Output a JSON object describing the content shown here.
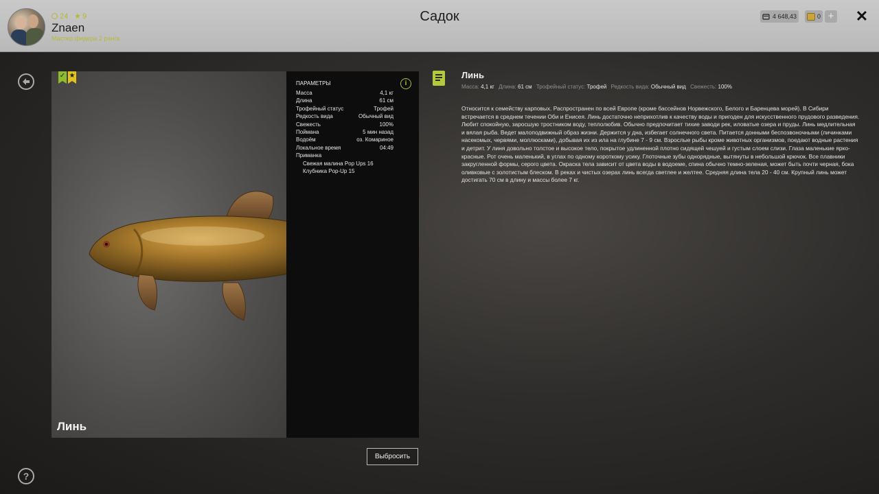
{
  "header": {
    "title": "Садок",
    "player": {
      "name": "Znaen",
      "rank": "Мастер фидера 2 ранга",
      "level": "24",
      "stars": "9"
    },
    "money": "4 648,43",
    "gold": "0",
    "plus_label": "+",
    "close_label": "✕"
  },
  "fish": {
    "name": "Линь",
    "colors": {
      "accent": "#b5c93e",
      "badge_green": "#8ebc2e",
      "badge_yellow": "#e2c21f"
    }
  },
  "params": {
    "title": "ПАРАМЕТРЫ",
    "rows": [
      {
        "label": "Масса",
        "value": "4,1 кг"
      },
      {
        "label": "Длина",
        "value": "61 см"
      },
      {
        "label": "Трофейный статус",
        "value": "Трофей"
      },
      {
        "label": "Редкость вида",
        "value": "Обычный вид"
      },
      {
        "label": "Свежесть",
        "value": "100%"
      },
      {
        "label": "Поймана",
        "value": "5 мин назад"
      },
      {
        "label": "Водоём",
        "value": "оз. Комариное"
      },
      {
        "label": "Локальное время",
        "value": "04:49"
      }
    ],
    "bait_label": "Приманка",
    "baits": [
      "Свежая малина Pop Ups 16",
      "Клубника Pop-Up 15"
    ]
  },
  "discard_label": "Выбросить",
  "description": {
    "title": "Линь",
    "meta": [
      {
        "label": "Масса:",
        "value": "4,1 кг"
      },
      {
        "label": "Длина:",
        "value": "61 см"
      },
      {
        "label": "Трофейный статус:",
        "value": "Трофей"
      },
      {
        "label": "Редкость вида:",
        "value": "Обычный вид"
      },
      {
        "label": "Свежесть:",
        "value": "100%"
      }
    ],
    "text": "Относится к семейству карповых. Распространен по всей Европе (кроме бассейнов Норвежского, Белого и Баренцева морей). В Сибири встречается в среднем течении Оби и Енисея. Линь достаточно неприхотлив к качеству воды и пригоден для искусственного прудового разведения. Любит спокойную, заросшую тростником воду, теплолюбив. Обычно предпочитает тихие заводи рек, иловатые озера и пруды. Линь медлительная и вялая рыба. Ведет малоподвижный образ жизни. Держится у дна, избегает солнечного света. Питается донными беспозвоночными (личинками насекомых, червями, моллюсками), добывая их из ила на глубине 7 - 9 см. Взрослые рыбы кроме животных организмов, поедают водные растения и детрит. У линя довольно толстое и высокое тело, покрытое удлиненной плотно сидящей чешуей и густым слоем слизи. Глаза маленькие ярко-красные. Рот очень маленький, в углах по одному короткому усику. Глоточные зубы однорядные, вытянуты в небольшой крючок. Все плавники закругленной формы, серого цвета. Окраска тела зависит от цвета воды в водоеме, спина обычно темно-зеленая, может быть почти черная, бока оливковые с золотистым блеском. В реках и чистых озерах линь всегда светлее и желтее. Средняя длина тела 20 - 40 см. Крупный линь может достигать 70 см в длину и массы более 7 кг."
  }
}
